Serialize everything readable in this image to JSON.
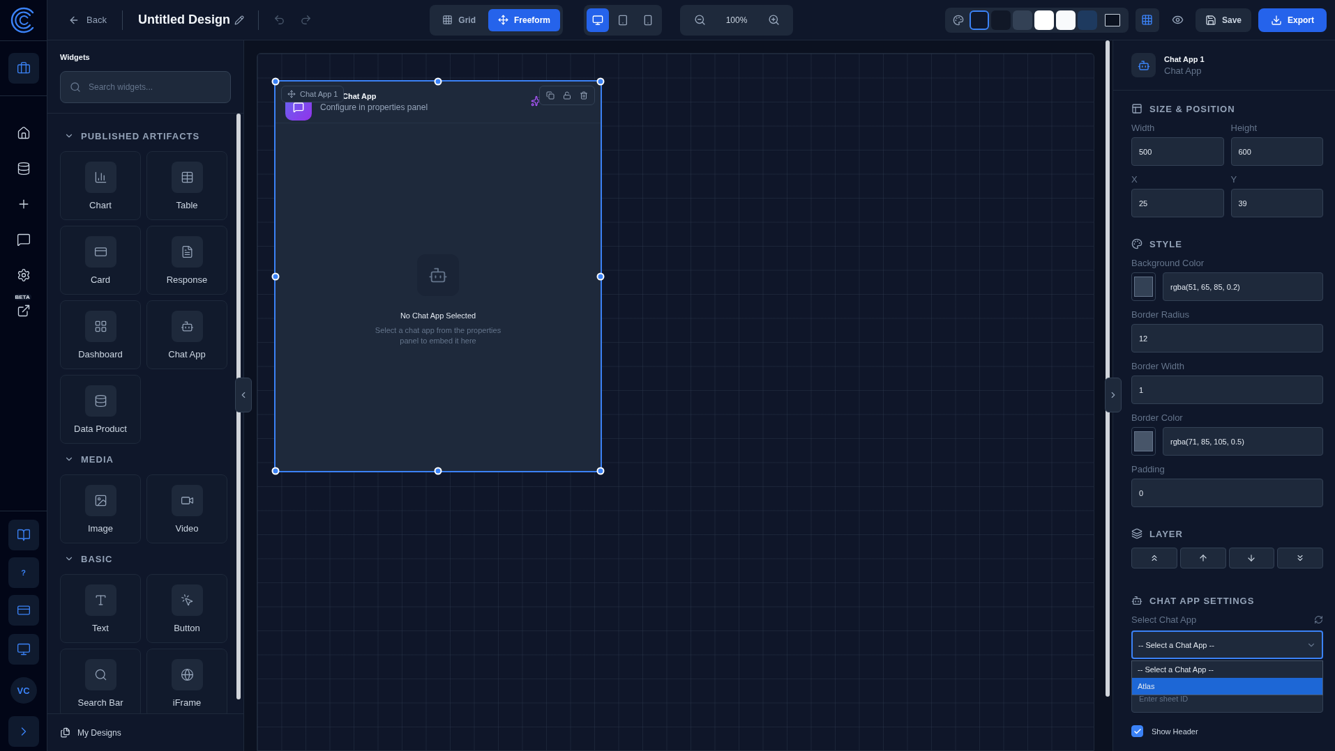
{
  "topbar": {
    "back_label": "Back",
    "title": "Untitled Design",
    "view_modes": [
      {
        "kind": "grid",
        "label": "Grid",
        "selected": false
      },
      {
        "kind": "freeform",
        "label": "Freeform",
        "selected": true
      }
    ],
    "devices": [
      {
        "kind": "desktop",
        "selected": true
      },
      {
        "kind": "tablet",
        "selected": false
      },
      {
        "kind": "mobile",
        "selected": false
      }
    ],
    "zoom": "100%",
    "swatches": [
      {
        "color": "#0f172a",
        "selected": true
      },
      {
        "color": "#111827",
        "selected": false
      },
      {
        "color": "#334155",
        "selected": false
      },
      {
        "color": "#ffffff",
        "selected": false
      },
      {
        "color": "#f8fafc",
        "selected": false
      },
      {
        "color": "#1e3a5f",
        "selected": false
      },
      {
        "color": "#0b1220",
        "selected": false
      }
    ],
    "grid_on": true,
    "save_label": "Save",
    "export_label": "Export"
  },
  "rail": {
    "top": [
      {
        "kind": "briefcase",
        "selected": true
      }
    ],
    "items": [
      {
        "kind": "home"
      },
      {
        "kind": "database"
      },
      {
        "kind": "plus"
      },
      {
        "kind": "chat"
      },
      {
        "kind": "settings"
      },
      {
        "kind": "external",
        "badge": "BETA"
      }
    ],
    "bottom": [
      {
        "kind": "book"
      },
      {
        "kind": "help",
        "label": "?"
      },
      {
        "kind": "card"
      },
      {
        "kind": "monitor"
      },
      {
        "kind": "avatar",
        "label": "VC"
      },
      {
        "kind": "expand"
      }
    ]
  },
  "widgets": {
    "title": "Widgets",
    "search_placeholder": "Search widgets...",
    "sections": [
      {
        "title": "PUBLISHED ARTIFACTS",
        "expanded": true,
        "items": [
          {
            "kind": "chart",
            "label": "Chart"
          },
          {
            "kind": "table",
            "label": "Table"
          },
          {
            "kind": "card",
            "label": "Card"
          },
          {
            "kind": "response",
            "label": "Response"
          },
          {
            "kind": "dashboard",
            "label": "Dashboard"
          },
          {
            "kind": "chatapp",
            "label": "Chat App"
          },
          {
            "kind": "dataproduct",
            "label": "Data Product"
          }
        ]
      },
      {
        "title": "MEDIA",
        "expanded": true,
        "items": [
          {
            "kind": "image",
            "label": "Image"
          },
          {
            "kind": "video",
            "label": "Video"
          }
        ]
      },
      {
        "title": "BASIC",
        "expanded": true,
        "items": [
          {
            "kind": "text",
            "label": "Text"
          },
          {
            "kind": "button",
            "label": "Button"
          },
          {
            "kind": "searchbar",
            "label": "Search Bar"
          },
          {
            "kind": "iframe",
            "label": "iFrame"
          }
        ]
      }
    ],
    "footer": "My Designs"
  },
  "canvas": {
    "element": {
      "tag": "Chat App 1",
      "title": "Chat App",
      "subtitle": "Configure in properties panel",
      "empty_title": "No Chat App Selected",
      "empty_text": "Select a chat app from the properties panel to embed it here",
      "selected": true
    }
  },
  "properties": {
    "name": "Chat App 1",
    "type": "Chat App",
    "size_title": "SIZE & POSITION",
    "size_fields": [
      {
        "label": "Width",
        "value": "500"
      },
      {
        "label": "Height",
        "value": "600"
      },
      {
        "label": "X",
        "value": "25"
      },
      {
        "label": "Y",
        "value": "39"
      }
    ],
    "style_title": "STYLE",
    "style_fields": [
      {
        "kind": "color",
        "label": "Background Color",
        "value": "rgba(51, 65, 85, 0.2)",
        "color": "#334155"
      },
      {
        "kind": "text",
        "label": "Border Radius",
        "value": "12"
      },
      {
        "kind": "text",
        "label": "Border Width",
        "value": "1"
      },
      {
        "kind": "color",
        "label": "Border Color",
        "value": "rgba(71, 85, 105, 0.5)",
        "color": "#475569"
      },
      {
        "kind": "text",
        "label": "Padding",
        "value": "0"
      }
    ],
    "layer_title": "LAYER",
    "layer_buttons": [
      {
        "kind": "front"
      },
      {
        "kind": "forward"
      },
      {
        "kind": "backward"
      },
      {
        "kind": "back"
      }
    ],
    "chat_title": "CHAT APP SETTINGS",
    "select_label": "Select Chat App",
    "select_value": "-- Select a Chat App --",
    "select_expanded": true,
    "options": [
      {
        "label": "-- Select a Chat App --",
        "highlighted": false
      },
      {
        "label": "Atlas",
        "highlighted": true
      }
    ],
    "sheet_placeholder": "Enter sheet ID",
    "show_header": {
      "label": "Show Header",
      "checked": true
    }
  }
}
